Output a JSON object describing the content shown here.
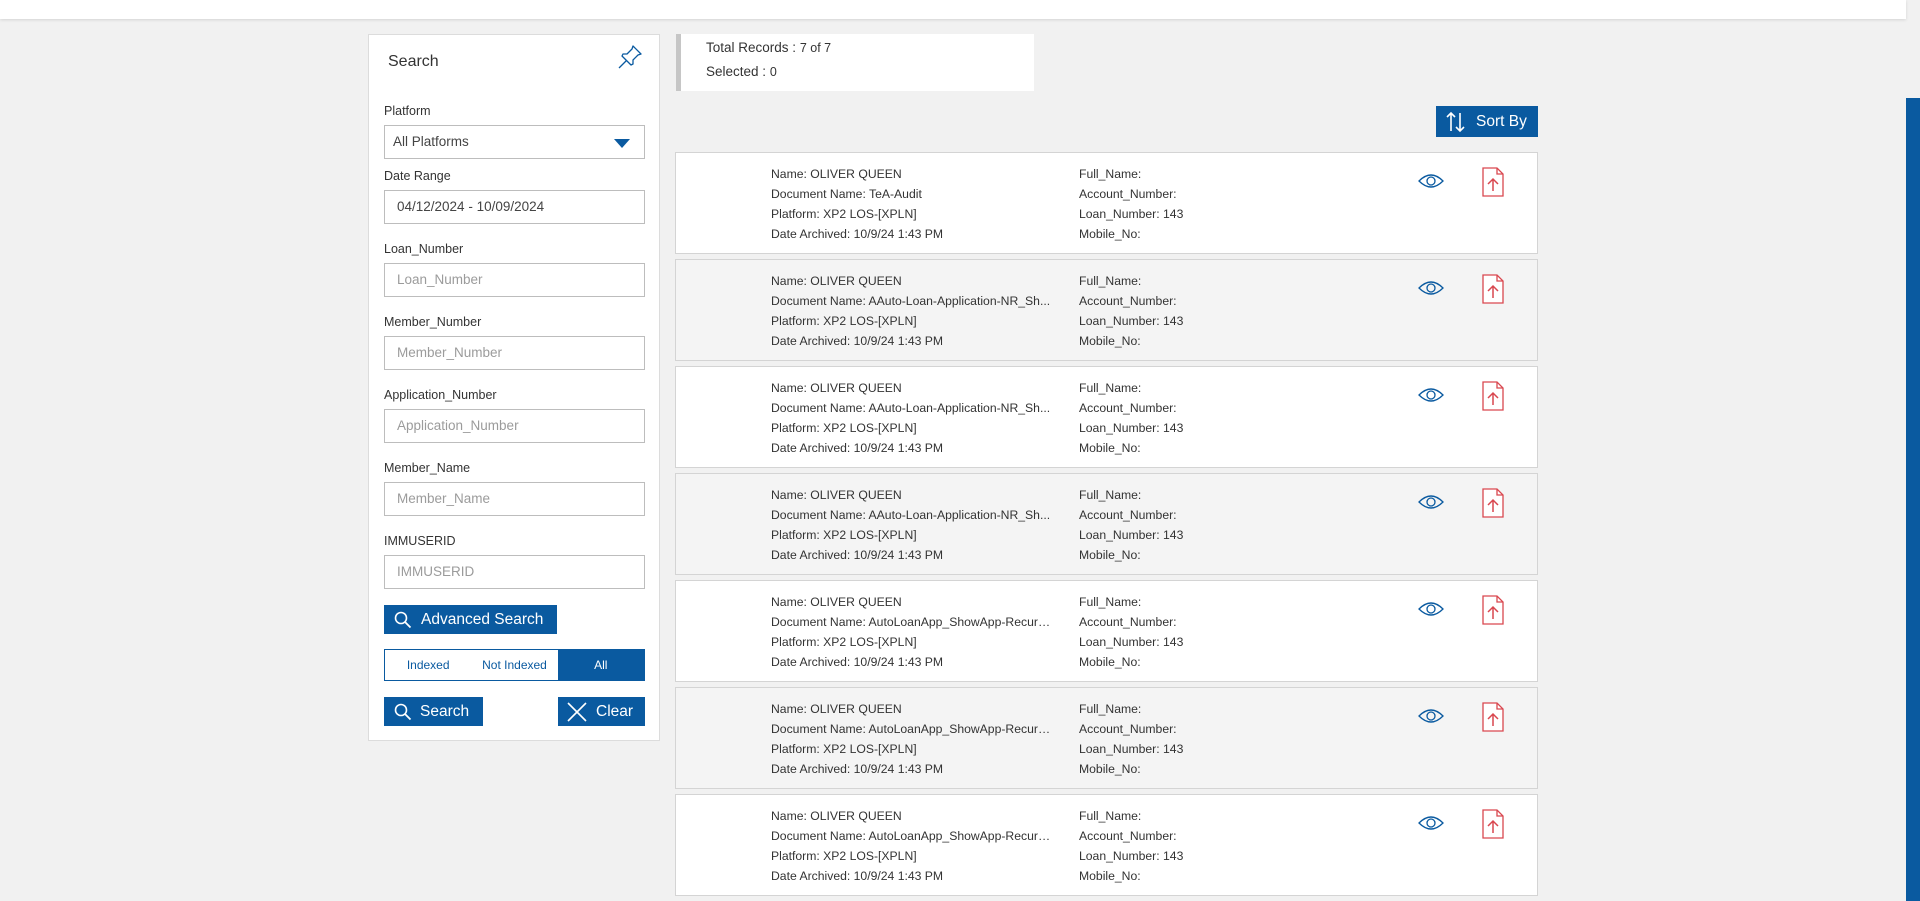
{
  "search": {
    "title": "Search",
    "platform_label": "Platform",
    "platform_value": "All Platforms",
    "date_label": "Date Range",
    "date_value": "04/12/2024 - 10/09/2024",
    "loan_label": "Loan_Number",
    "loan_placeholder": "Loan_Number",
    "member_number_label": "Member_Number",
    "member_number_placeholder": "Member_Number",
    "application_label": "Application_Number",
    "application_placeholder": "Application_Number",
    "member_name_label": "Member_Name",
    "member_name_placeholder": "Member_Name",
    "immuserid_label": "IMMUSERID",
    "immuserid_placeholder": "IMMUSERID",
    "advanced_label": "Advanced Search",
    "toggle": {
      "indexed": "Indexed",
      "not_indexed": "Not Indexed",
      "all": "All",
      "selected": "All"
    },
    "search_label": "Search",
    "clear_label": "Clear"
  },
  "summary": {
    "total_label": "Total Records :",
    "total_value": "7 of 7",
    "selected_label": "Selected :",
    "selected_value": "0"
  },
  "sort_label": "Sort By",
  "colors": {
    "accent": "#0a5aa0",
    "pdf_icon": "#d9474f",
    "background": "#f1f1f1"
  },
  "records": [
    {
      "name": "Name: OLIVER QUEEN",
      "document": "Document Name: TeA-Audit",
      "platform": "Platform: XP2 LOS-[XPLN]",
      "date": "Date Archived: 10/9/24 1:43 PM",
      "full_name": "Full_Name:",
      "account": "Account_Number:",
      "loan": "Loan_Number: 143",
      "mobile": "Mobile_No:"
    },
    {
      "name": "Name: OLIVER QUEEN",
      "document": "Document Name: AAuto-Loan-Application-NR_Sh...",
      "platform": "Platform: XP2 LOS-[XPLN]",
      "date": "Date Archived: 10/9/24 1:43 PM",
      "full_name": "Full_Name:",
      "account": "Account_Number:",
      "loan": "Loan_Number: 143",
      "mobile": "Mobile_No:"
    },
    {
      "name": "Name: OLIVER QUEEN",
      "document": "Document Name: AAuto-Loan-Application-NR_Sh...",
      "platform": "Platform: XP2 LOS-[XPLN]",
      "date": "Date Archived: 10/9/24 1:43 PM",
      "full_name": "Full_Name:",
      "account": "Account_Number:",
      "loan": "Loan_Number: 143",
      "mobile": "Mobile_No:"
    },
    {
      "name": "Name: OLIVER QUEEN",
      "document": "Document Name: AAuto-Loan-Application-NR_Sh...",
      "platform": "Platform: XP2 LOS-[XPLN]",
      "date": "Date Archived: 10/9/24 1:43 PM",
      "full_name": "Full_Name:",
      "account": "Account_Number:",
      "loan": "Loan_Number: 143",
      "mobile": "Mobile_No:"
    },
    {
      "name": "Name: OLIVER QUEEN",
      "document": "Document Name: AutoLoanApp_ShowApp-Recurri...",
      "platform": "Platform: XP2 LOS-[XPLN]",
      "date": "Date Archived: 10/9/24 1:43 PM",
      "full_name": "Full_Name:",
      "account": "Account_Number:",
      "loan": "Loan_Number: 143",
      "mobile": "Mobile_No:"
    },
    {
      "name": "Name: OLIVER QUEEN",
      "document": "Document Name: AutoLoanApp_ShowApp-Recurri...",
      "platform": "Platform: XP2 LOS-[XPLN]",
      "date": "Date Archived: 10/9/24 1:43 PM",
      "full_name": "Full_Name:",
      "account": "Account_Number:",
      "loan": "Loan_Number: 143",
      "mobile": "Mobile_No:"
    },
    {
      "name": "Name: OLIVER QUEEN",
      "document": "Document Name: AutoLoanApp_ShowApp-Recurri...",
      "platform": "Platform: XP2 LOS-[XPLN]",
      "date": "Date Archived: 10/9/24 1:43 PM",
      "full_name": "Full_Name:",
      "account": "Account_Number:",
      "loan": "Loan_Number: 143",
      "mobile": "Mobile_No:"
    }
  ]
}
